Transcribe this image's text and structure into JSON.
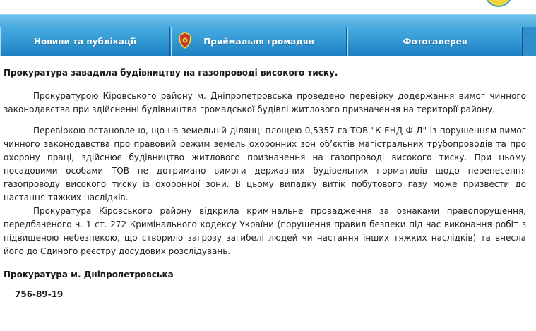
{
  "colors": {
    "nav_top": "#6ec4ec",
    "nav_bottom": "#1a7cc0",
    "nav_text": "#ffffff",
    "body_text": "#1a1a1a",
    "logo_accent": "#f2d43a"
  },
  "nav": {
    "tabs": [
      {
        "label": "Новини та публікації"
      },
      {
        "label": "Приймальня громадян",
        "icon": "emblem-icon"
      },
      {
        "label": "Фотогалерея"
      }
    ]
  },
  "article": {
    "title": "Прокуратура завадила будівництву на газопроводі високого тиску.",
    "paragraphs": [
      "Прокуратурою Кіровського району м. Дніпропетровська проведено перевірку додержання вимог чинного законодавства при здійсненні будівництва громадської будівлі житлового призначення на території району.",
      "Перевіркою встановлено, що на земельній ділянці площею 0,5357 га ТОВ \"К ЕНД Ф Д\" із порушенням вимог чинного законодавства про правовий режим земель охоронних зон об’єктів магістральних трубопроводів та про охорону праці, здійснює будівництво житлового призначення на газопроводі високого тиску. При цьому посадовими особами ТОВ не дотримано вимоги державних будівельних нормативів щодо перенесення газопроводу високого тиску із охоронної зони. В цьому випадку витік побутового газу може призвести до настання тяжких наслідків.",
      "Прокуратура Кіровського району відкрила кримінальне провадження за ознаками правопорушення, передбаченого ч. 1 ст. 272 Кримінального кодексу України (порушення правил безпеки під час виконання робіт з підвищеною небезпекою, що створило загрозу загибелі людей чи настання інших тяжких наслідків) та внесла його до Єдиного реєстру досудових розслідувань."
    ]
  },
  "footer": {
    "organization": "Прокуратура м. Дніпропетровська",
    "phone": "756-89-19"
  }
}
